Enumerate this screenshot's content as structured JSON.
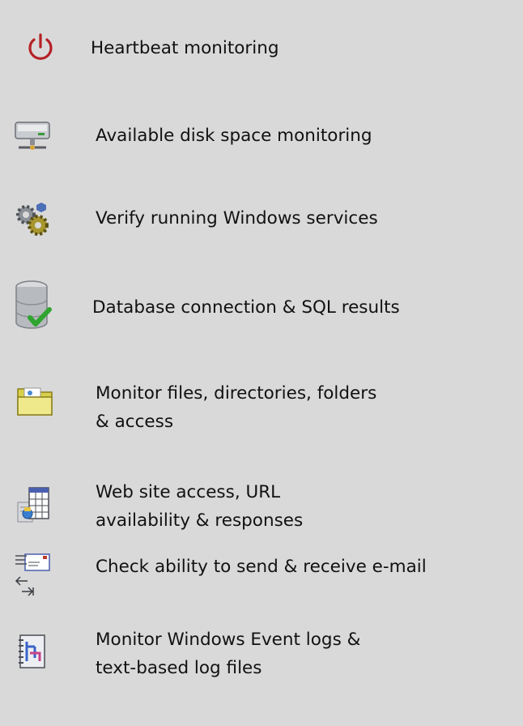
{
  "features": [
    {
      "icon": "power-icon",
      "lines": [
        "Heartbeat monitoring"
      ]
    },
    {
      "icon": "server-icon",
      "lines": [
        "Available disk space monitoring"
      ]
    },
    {
      "icon": "gears-icon",
      "lines": [
        "Verify running Windows services"
      ]
    },
    {
      "icon": "database-check-icon",
      "lines": [
        "Database connection & SQL results"
      ]
    },
    {
      "icon": "folder-icon",
      "lines": [
        "Monitor files, directories, folders",
        "& access"
      ]
    },
    {
      "icon": "web-page-icon",
      "lines": [
        "Web site access, URL",
        "availability & responses"
      ]
    },
    {
      "icon": "email-icon",
      "lines": [
        "Check ability to send & receive e-mail"
      ]
    },
    {
      "icon": "log-file-icon",
      "lines": [
        "Monitor Windows Event logs &",
        "text-based log files"
      ]
    }
  ],
  "colors": {
    "background": "#d9d9d9",
    "text": "#111111",
    "power": "#b52025",
    "check": "#2fa52f"
  }
}
